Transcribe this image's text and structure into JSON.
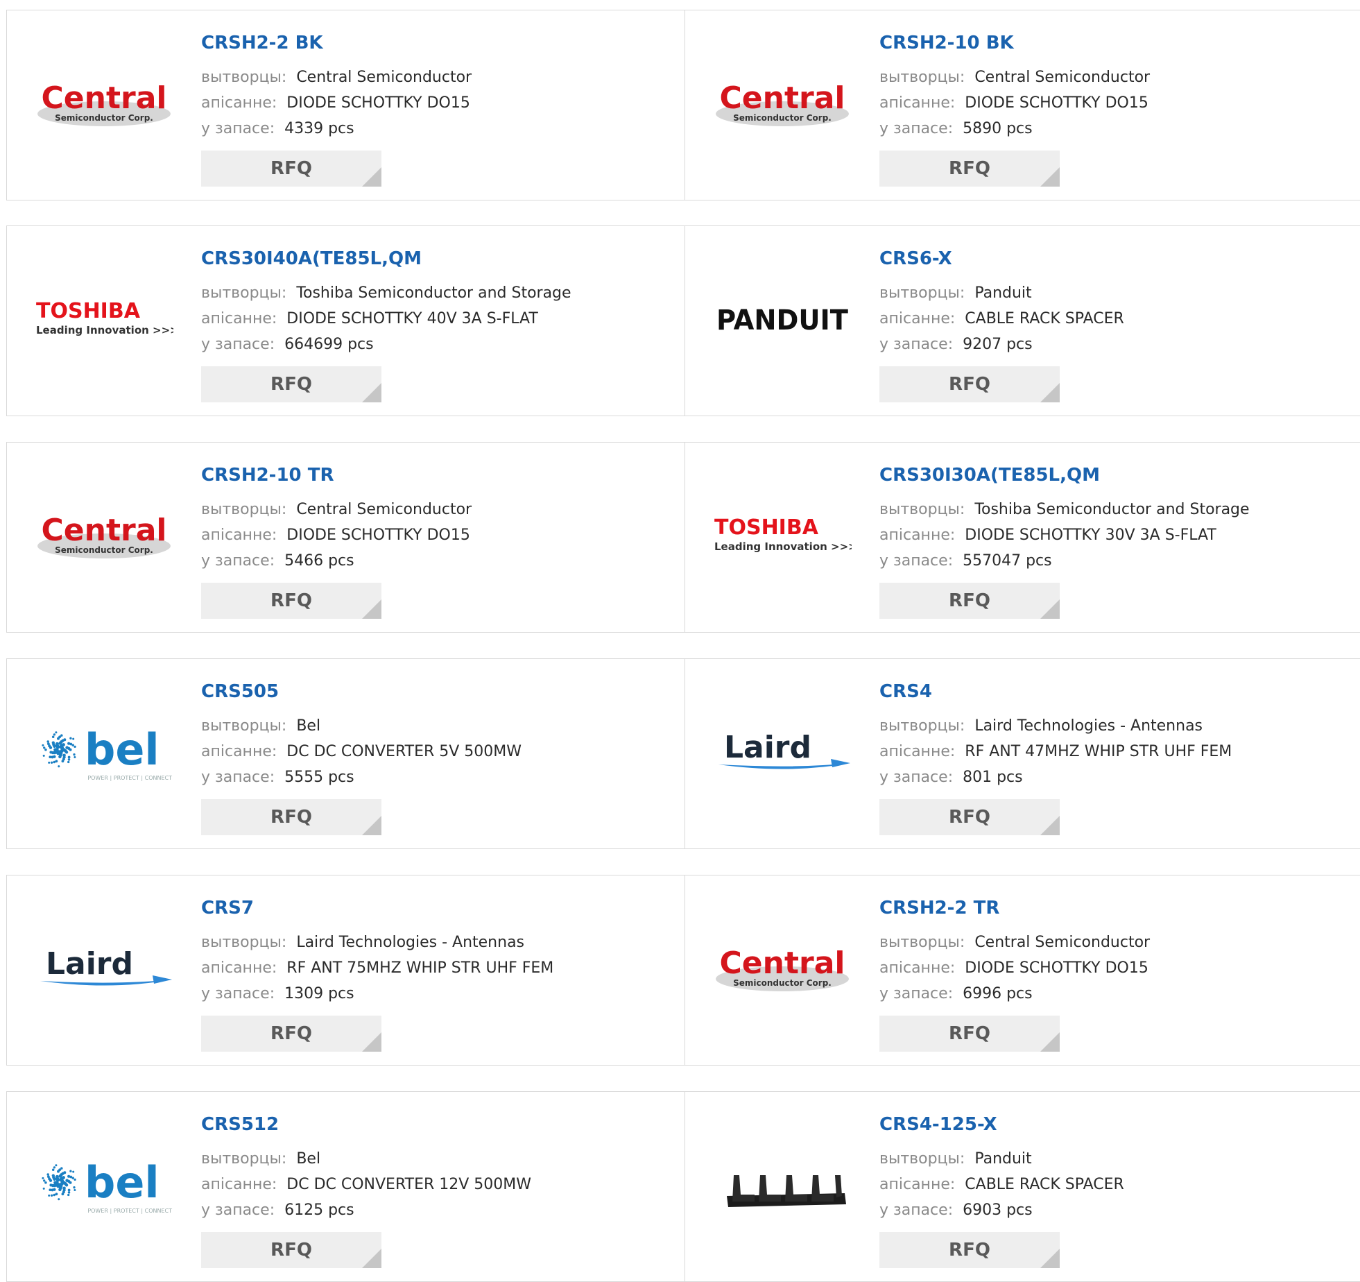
{
  "labels": {
    "manufacturer": "вытворцы:",
    "description": "апісанне:",
    "stock": "у запасе:"
  },
  "rfq_label": "RFQ",
  "brand_colors": {
    "link": "#1a62ae",
    "central_red": "#d4151c",
    "toshiba_red": "#e4131b",
    "bel_blue": "#1a7fc3",
    "laird_dark": "#1c2a3a",
    "laird_blue": "#2d88d6"
  },
  "logos": {
    "central": {
      "name": "Central",
      "sub": "Semiconductor Corp."
    },
    "toshiba": {
      "name": "TOSHIBA",
      "sub": "Leading Innovation >>>"
    },
    "panduit": {
      "name": "PANDUIT"
    },
    "bel": {
      "name": "bel",
      "sub": "POWER | PROTECT | CONNECT"
    },
    "laird": {
      "name": "Laird"
    },
    "rack_spacer": {
      "icon": "cable-rack-spacer-image"
    }
  },
  "products": [
    {
      "part": "CRSH2-2 BK",
      "manufacturer": "Central Semiconductor",
      "description": "DIODE SCHOTTKY DO15",
      "stock": "4339 pcs",
      "logo": "central"
    },
    {
      "part": "CRSH2-10 BK",
      "manufacturer": "Central Semiconductor",
      "description": "DIODE SCHOTTKY DO15",
      "stock": "5890 pcs",
      "logo": "central"
    },
    {
      "part": "CRS30I40A(TE85L,QM",
      "manufacturer": "Toshiba Semiconductor and Storage",
      "description": "DIODE SCHOTTKY 40V 3A S-FLAT",
      "stock": "664699 pcs",
      "logo": "toshiba"
    },
    {
      "part": "CRS6-X",
      "manufacturer": "Panduit",
      "description": "CABLE RACK SPACER",
      "stock": "9207 pcs",
      "logo": "panduit"
    },
    {
      "part": "CRSH2-10 TR",
      "manufacturer": "Central Semiconductor",
      "description": "DIODE SCHOTTKY DO15",
      "stock": "5466 pcs",
      "logo": "central"
    },
    {
      "part": "CRS30I30A(TE85L,QM",
      "manufacturer": "Toshiba Semiconductor and Storage",
      "description": "DIODE SCHOTTKY 30V 3A S-FLAT",
      "stock": "557047 pcs",
      "logo": "toshiba"
    },
    {
      "part": "CRS505",
      "manufacturer": "Bel",
      "description": "DC DC CONVERTER 5V 500MW",
      "stock": "5555 pcs",
      "logo": "bel"
    },
    {
      "part": "CRS4",
      "manufacturer": "Laird Technologies - Antennas",
      "description": "RF ANT 47MHZ WHIP STR UHF FEM",
      "stock": "801 pcs",
      "logo": "laird"
    },
    {
      "part": "CRS7",
      "manufacturer": "Laird Technologies - Antennas",
      "description": "RF ANT 75MHZ WHIP STR UHF FEM",
      "stock": "1309 pcs",
      "logo": "laird"
    },
    {
      "part": "CRSH2-2 TR",
      "manufacturer": "Central Semiconductor",
      "description": "DIODE SCHOTTKY DO15",
      "stock": "6996 pcs",
      "logo": "central"
    },
    {
      "part": "CRS512",
      "manufacturer": "Bel",
      "description": "DC DC CONVERTER 12V 500MW",
      "stock": "6125 pcs",
      "logo": "bel"
    },
    {
      "part": "CRS4-125-X",
      "manufacturer": "Panduit",
      "description": "CABLE RACK SPACER",
      "stock": "6903 pcs",
      "logo": "rack_spacer"
    }
  ]
}
